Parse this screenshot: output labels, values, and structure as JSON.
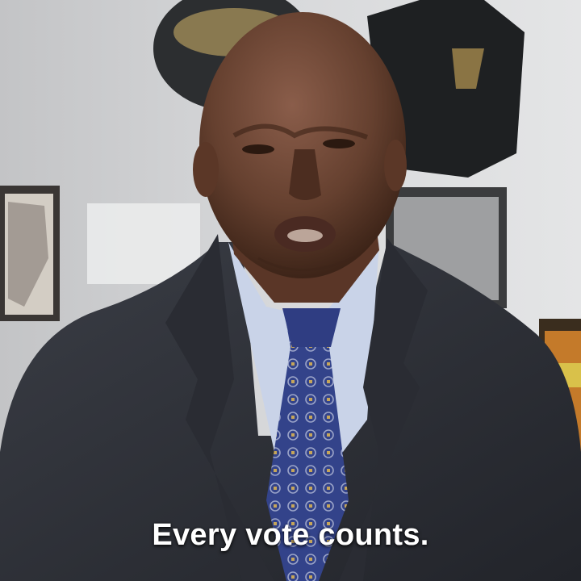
{
  "video": {
    "caption": "Every vote counts."
  },
  "colors": {
    "wall": "#d4d5d7",
    "suit": "#2d3037",
    "shirt": "#c9d3e8",
    "tie": "#3a4a8c",
    "skin": "#6b4535"
  }
}
